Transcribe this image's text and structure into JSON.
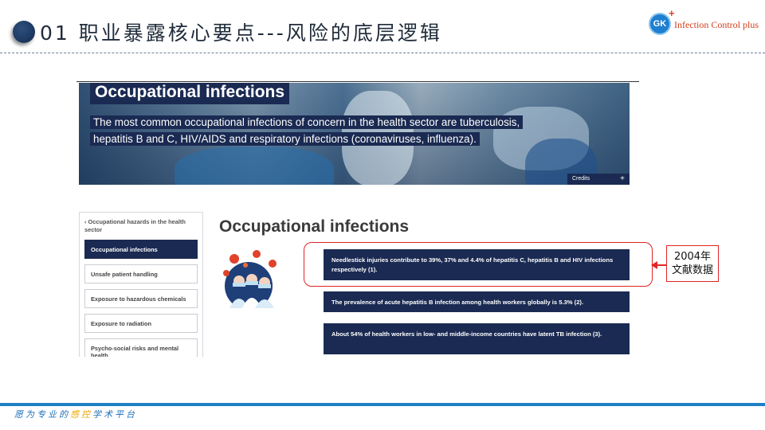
{
  "slide": {
    "title": "01 职业暴露核心要点---风险的底层逻辑",
    "brand": "Infection Control plus",
    "brand_logo": "GK",
    "footer_part1": "愿为专业的",
    "footer_highlight": "感控",
    "footer_part2": "学术平台"
  },
  "hero": {
    "title": "Occupational infections",
    "body": "The most common occupational infections of concern in the health sector are tuberculosis, hepatitis B and C, HIV/AIDS and respiratory infections (coronaviruses, influenza).",
    "credits_label": "Credits",
    "credits_plus": "+"
  },
  "sidebar": {
    "back_label": "Occupational hazards in the health sector",
    "items": [
      {
        "label": "Occupational infections",
        "active": true
      },
      {
        "label": "Unsafe patient handling",
        "active": false
      },
      {
        "label": "Exposure to hazardous chemicals",
        "active": false
      },
      {
        "label": "Exposure to radiation",
        "active": false
      },
      {
        "label": "Psycho-social risks and mental health",
        "active": false
      }
    ]
  },
  "main": {
    "title": "Occupational infections",
    "facts": [
      "Needlestick injuries contribute to 39%, 37% and 4.4% of hepatitis C, hepatitis B and HIV infections respectively (1).",
      "The prevalence of acute hepatitis B infection among health workers globally is 5.3% (2).",
      "About 54% of health workers in low- and middle-income countries have latent TB infection (3)."
    ]
  },
  "annotation": {
    "line1": "2004年",
    "line2": "文献数据"
  },
  "colors": {
    "navy": "#1a2a52",
    "accent_red": "#e02424",
    "footer_blue": "#1e7fc4",
    "footer_highlight": "#f0a800"
  }
}
